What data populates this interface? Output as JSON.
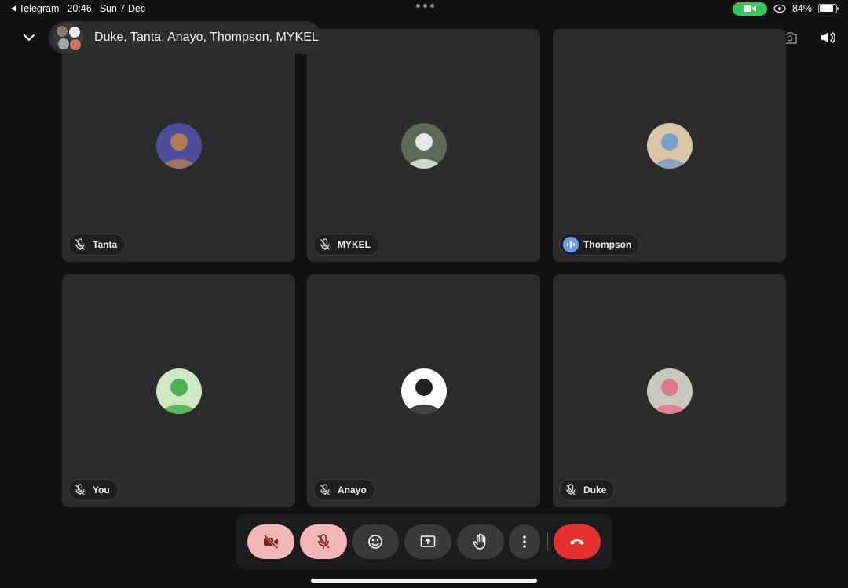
{
  "statusbar": {
    "back_app": "Telegram",
    "time": "20:46",
    "date": "Sun 7 Dec",
    "battery": "84%",
    "battery_level": 0.84
  },
  "call": {
    "title": "Duke, Tanta, Anayo, Thompson, MYKEL"
  },
  "participants": [
    {
      "name": "Tanta",
      "mic": "muted",
      "avatar_bg": "#4b4e9a",
      "avatar_fg": "#b07a55"
    },
    {
      "name": "MYKEL",
      "mic": "muted",
      "avatar_bg": "#5a6a55",
      "avatar_fg": "#e8e8e8"
    },
    {
      "name": "Thompson",
      "mic": "speaking",
      "avatar_bg": "#d9c7a8",
      "avatar_fg": "#7aa0c8"
    },
    {
      "name": "You",
      "mic": "muted",
      "avatar_bg": "#cfe8c4",
      "avatar_fg": "#4caf50"
    },
    {
      "name": "Anayo",
      "mic": "muted",
      "avatar_bg": "#ffffff",
      "avatar_fg": "#222222"
    },
    {
      "name": "Duke",
      "mic": "muted",
      "avatar_bg": "#c9c9c0",
      "avatar_fg": "#e07a8a"
    }
  ],
  "colors": {
    "tile_bg": "#2b2b2d",
    "accent_speaking": "#6d9bf1",
    "end_call": "#e5322d",
    "muted_button": "#f2b8b8",
    "battery_cam": "#34c759"
  },
  "controls": [
    {
      "name": "camera-off",
      "icon": "video-off-icon",
      "state": "off"
    },
    {
      "name": "mic-off",
      "icon": "mic-off-icon",
      "state": "off"
    },
    {
      "name": "reactions",
      "icon": "smiley-icon"
    },
    {
      "name": "share-screen",
      "icon": "screen-share-icon"
    },
    {
      "name": "raise-hand",
      "icon": "hand-icon"
    },
    {
      "name": "more",
      "icon": "more-vertical-icon"
    },
    {
      "name": "end-call",
      "icon": "phone-hangup-icon"
    }
  ]
}
